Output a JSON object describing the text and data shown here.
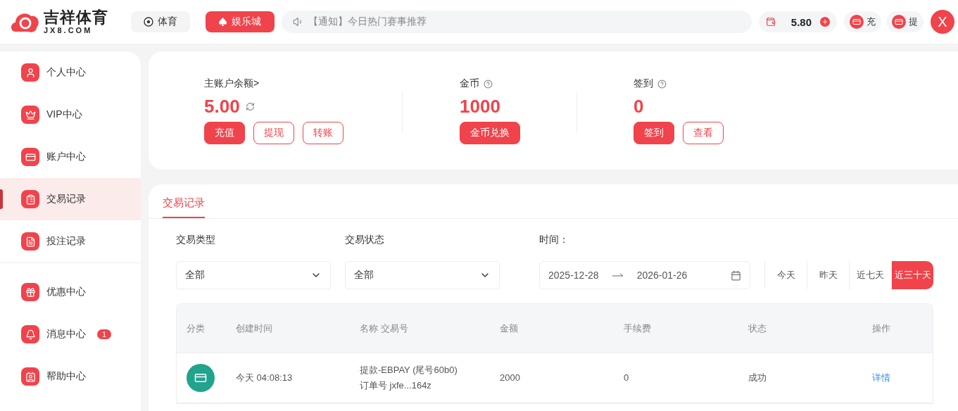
{
  "header": {
    "logo": {
      "name": "吉祥体育",
      "domain": "JX8.COM"
    },
    "nav": [
      {
        "label": "体育",
        "selected": false
      },
      {
        "label": "娱乐城",
        "selected": true
      }
    ],
    "notice": "【通知】今日热门赛事推荐",
    "balance": "5.80",
    "actions": [
      "充",
      "提"
    ],
    "close": "X"
  },
  "sidebar": {
    "groups": [
      [
        {
          "label": "个人中心",
          "selected": false
        },
        {
          "label": "VIP中心",
          "selected": false
        },
        {
          "label": "账户中心",
          "selected": false
        },
        {
          "label": "交易记录",
          "selected": true
        },
        {
          "label": "投注记录",
          "selected": false
        }
      ],
      [
        {
          "label": "优惠中心",
          "selected": false
        },
        {
          "label": "消息中心",
          "selected": false,
          "badge": "1"
        },
        {
          "label": "帮助中心",
          "selected": false
        }
      ]
    ]
  },
  "summary": [
    {
      "label": "主账户余额>",
      "value": "5.00",
      "refresh": true,
      "help": false,
      "buttons": [
        {
          "label": "充值",
          "kind": "primary"
        },
        {
          "label": "提现",
          "kind": "outline"
        },
        {
          "label": "转账",
          "kind": "outline"
        }
      ]
    },
    {
      "label": "金币",
      "value": "1000",
      "refresh": false,
      "help": true,
      "buttons": [
        {
          "label": "金币兑换",
          "kind": "primary"
        }
      ]
    },
    {
      "label": "签到",
      "value": "0",
      "refresh": false,
      "help": true,
      "buttons": [
        {
          "label": "签到",
          "kind": "primary"
        },
        {
          "label": "查看",
          "kind": "outline"
        }
      ]
    }
  ],
  "tabs": [
    {
      "label": "交易记录",
      "selected": true
    }
  ],
  "filters": {
    "type": {
      "label": "交易类型",
      "value": "全部"
    },
    "status": {
      "label": "交易状态",
      "value": "全部"
    },
    "time": {
      "label": "时间：",
      "start": "2025-12-28",
      "end": "2026-01-26"
    },
    "ranges": [
      {
        "label": "今天",
        "selected": false
      },
      {
        "label": "昨天",
        "selected": false
      },
      {
        "label": "近七天",
        "selected": false
      },
      {
        "label": "近三十天",
        "selected": true
      }
    ]
  },
  "table": {
    "columns": [
      "分类",
      "创建时间",
      "名称 交易号",
      "金额",
      "手续费",
      "状态",
      "操作"
    ],
    "rows": [
      {
        "created": "今天 04:08:13",
        "name": "提款-EBPAY (尾号60b0)",
        "order": "订单号 jxfe...164z",
        "amount": "2000",
        "fee": "0",
        "status": "成功",
        "action": "详情"
      }
    ]
  }
}
